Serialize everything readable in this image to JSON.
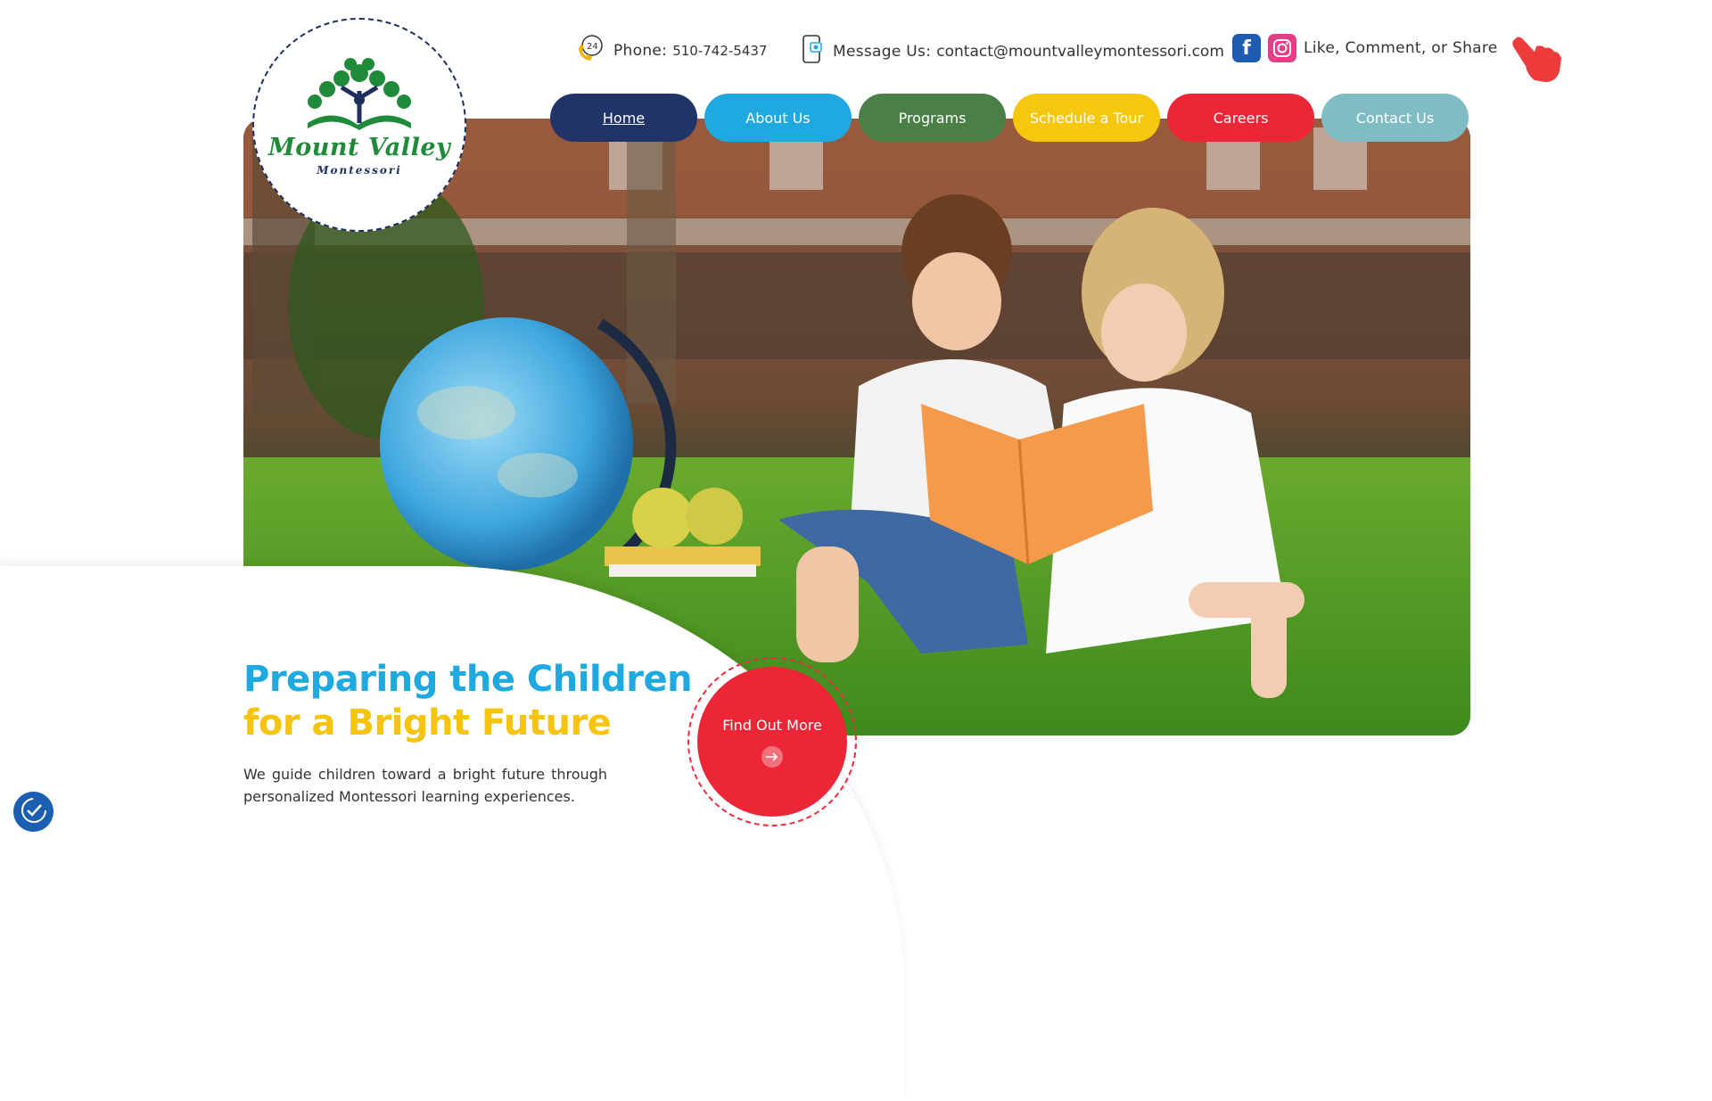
{
  "brand": {
    "name": "Mount Valley",
    "subtitle": "Montessori"
  },
  "contact": {
    "phone_label": "Phone:",
    "phone": "510-742-5437",
    "message_label": "Message Us:",
    "email": "contact@mountvalleymontessori.com",
    "social_label": "Like, Comment, or Share"
  },
  "nav": {
    "items": [
      {
        "label": "Home",
        "color": "#213468"
      },
      {
        "label": "About Us",
        "color": "#1ea9e1"
      },
      {
        "label": "Programs",
        "color": "#4a7f45"
      },
      {
        "label": "Schedule a Tour",
        "color": "#f6c70f"
      },
      {
        "label": "Careers",
        "color": "#ec2537"
      },
      {
        "label": "Contact Us",
        "color": "#80bcc4"
      }
    ]
  },
  "hero": {
    "headline_line1": "Preparing the Children",
    "headline_line2": "for a Bright Future",
    "description": "We guide children toward a bright future through personalized Montessori learning experiences.",
    "cta_label": "Find Out More"
  },
  "colors": {
    "navy": "#213468",
    "blue": "#1ea9e1",
    "yellow": "#f6c40e",
    "red": "#ec2537"
  },
  "icons": [
    "phone-24-icon",
    "message-phone-icon",
    "facebook-icon",
    "instagram-icon",
    "pointing-hand-icon",
    "arrow-right-icon",
    "accessibility-icon"
  ]
}
